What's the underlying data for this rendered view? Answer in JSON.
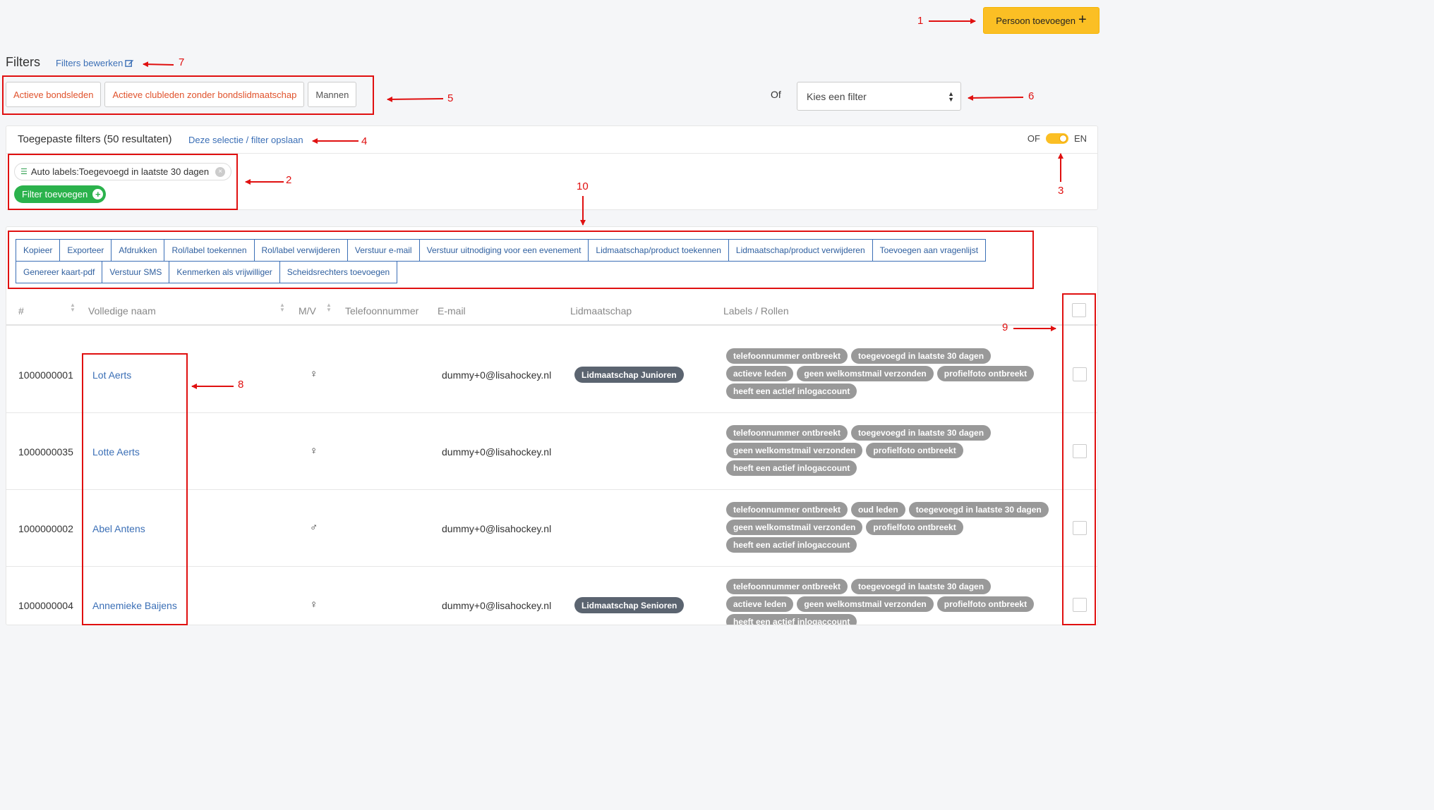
{
  "header": {
    "add_person_label": "Persoon toevoegen",
    "add_icon": "plus-icon"
  },
  "filters": {
    "title": "Filters",
    "edit_label": "Filters bewerken",
    "saved": [
      "Actieve bondsleden",
      "Actieve clubleden zonder bondslidmaatschap",
      "Mannen"
    ],
    "or_label": "Of",
    "select_placeholder": "Kies een filter"
  },
  "applied": {
    "title": "Toegepaste filters (50 resultaten)",
    "save_label": "Deze selectie / filter opslaan",
    "toggle_left": "OF",
    "toggle_right": "EN",
    "toggle_state": "EN",
    "chip_label": "Auto labels:Toegevoegd in laatste 30 dagen",
    "add_filter_label": "Filter toevoegen"
  },
  "actions": {
    "row1": [
      "Kopieer",
      "Exporteer",
      "Afdrukken",
      "Rol/label toekennen",
      "Rol/label verwijderen",
      "Verstuur e-mail",
      "Verstuur uitnodiging voor een evenement",
      "Lidmaatschap/product toekennen",
      "Lidmaatschap/product verwijderen",
      "Toevoegen aan vragenlijst"
    ],
    "row2": [
      "Genereer kaart-pdf",
      "Verstuur SMS",
      "Kenmerken als vrijwilliger",
      "Scheidsrechters toevoegen"
    ]
  },
  "table": {
    "headers": {
      "id": "#",
      "name": "Volledige naam",
      "gender": "M/V",
      "phone": "Telefoonnummer",
      "email": "E-mail",
      "membership": "Lidmaatschap",
      "labels": "Labels / Rollen"
    },
    "rows": [
      {
        "id": "1000000001",
        "name": "Lot Aerts",
        "gender": "♀",
        "email": "dummy+0@lisahockey.nl",
        "membership": "Lidmaatschap Junioren",
        "labels": [
          "telefoonnummer ontbreekt",
          "toegevoegd in laatste 30 dagen",
          "actieve leden",
          "geen welkomstmail verzonden",
          "profielfoto ontbreekt",
          "heeft een actief inlogaccount"
        ]
      },
      {
        "id": "1000000035",
        "name": "Lotte Aerts",
        "gender": "♀",
        "email": "dummy+0@lisahockey.nl",
        "membership": "",
        "labels": [
          "telefoonnummer ontbreekt",
          "toegevoegd in laatste 30 dagen",
          "geen welkomstmail verzonden",
          "profielfoto ontbreekt",
          "heeft een actief inlogaccount"
        ]
      },
      {
        "id": "1000000002",
        "name": "Abel Antens",
        "gender": "♂",
        "email": "dummy+0@lisahockey.nl",
        "membership": "",
        "labels": [
          "telefoonnummer ontbreekt",
          "oud leden",
          "toegevoegd in laatste 30 dagen",
          "geen welkomstmail verzonden",
          "profielfoto ontbreekt",
          "heeft een actief inlogaccount"
        ]
      },
      {
        "id": "1000000004",
        "name": "Annemieke Baijens",
        "gender": "♀",
        "email": "dummy+0@lisahockey.nl",
        "membership": "Lidmaatschap Senioren",
        "labels": [
          "telefoonnummer ontbreekt",
          "toegevoegd in laatste 30 dagen",
          "actieve leden",
          "geen welkomstmail verzonden",
          "profielfoto ontbreekt",
          "heeft een actief inlogaccount"
        ]
      }
    ]
  },
  "annotations": [
    "1",
    "2",
    "3",
    "4",
    "5",
    "6",
    "7",
    "8",
    "9",
    "10"
  ],
  "colors": {
    "accent_yellow": "#fbbf24",
    "link_blue": "#3b6fb6",
    "add_green": "#2bb24c",
    "annotation_red": "#e01010",
    "label_gray": "#999999",
    "badge_dark": "#5b6470"
  }
}
